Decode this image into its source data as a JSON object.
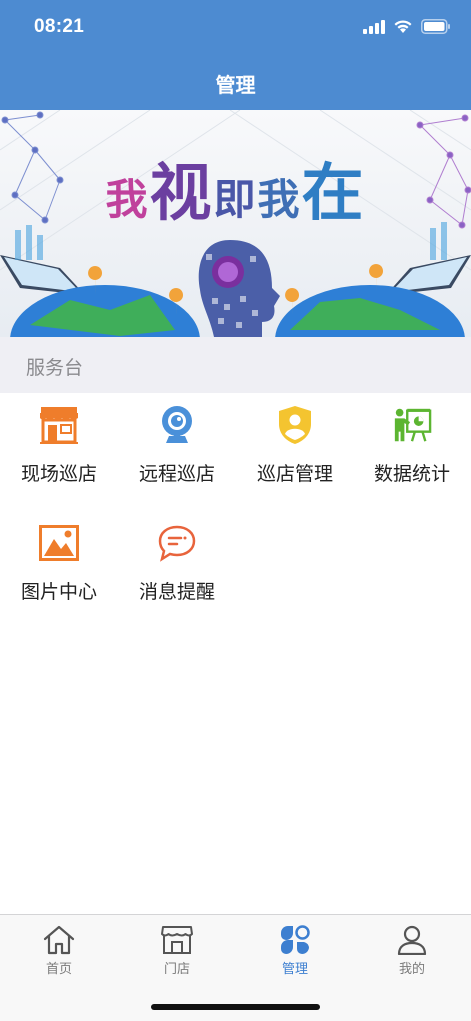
{
  "status_bar": {
    "time": "08:21"
  },
  "nav": {
    "title": "管理"
  },
  "banner": {
    "slogan": [
      "我",
      "视",
      "即",
      "我",
      "在"
    ]
  },
  "section": {
    "title": "服务台"
  },
  "grid_items": [
    {
      "label": "现场巡店",
      "icon": "storefront-icon"
    },
    {
      "label": "远程巡店",
      "icon": "webcam-icon"
    },
    {
      "label": "巡店管理",
      "icon": "user-shield-icon"
    },
    {
      "label": "数据统计",
      "icon": "presentation-icon"
    },
    {
      "label": "图片中心",
      "icon": "picture-icon"
    },
    {
      "label": "消息提醒",
      "icon": "chat-bubble-icon"
    }
  ],
  "tabbar": {
    "items": [
      {
        "label": "首页",
        "icon": "home-icon"
      },
      {
        "label": "门店",
        "icon": "store-icon"
      },
      {
        "label": "管理",
        "icon": "manage-icon",
        "active": true
      },
      {
        "label": "我的",
        "icon": "person-icon"
      }
    ]
  },
  "colors": {
    "header": "#4d8bd1",
    "active_tab": "#3d7fd0",
    "inactive_tab": "#7b7b7b",
    "section_bg": "#efeff4",
    "store_orange": "#ef7d2b",
    "camera_blue": "#4a90d9",
    "shield_yellow": "#f4c430",
    "stats_green": "#5cb531",
    "chat_red": "#e8643c"
  }
}
